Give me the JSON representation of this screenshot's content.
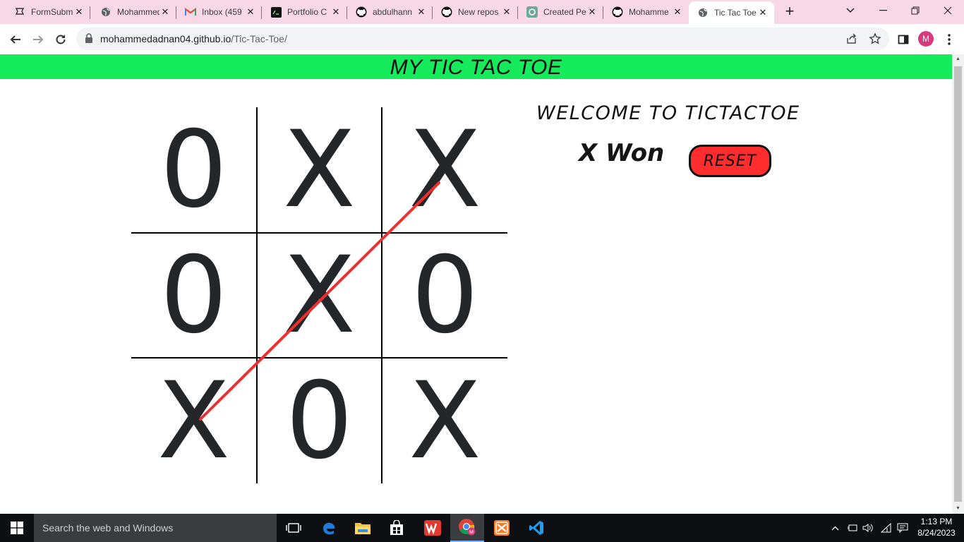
{
  "browser": {
    "tabs": [
      {
        "title": "FormSubmit",
        "icon": "formsubmit-icon"
      },
      {
        "title": "Mohammed",
        "icon": "globe-icon"
      },
      {
        "title": "Inbox (459",
        "icon": "gmail-icon"
      },
      {
        "title": "Portfolio C",
        "icon": "codepen-icon"
      },
      {
        "title": "abdulhann",
        "icon": "github-icon"
      },
      {
        "title": "New repos",
        "icon": "github-icon"
      },
      {
        "title": "Created Pe",
        "icon": "chatgpt-icon"
      },
      {
        "title": "Mohamme",
        "icon": "github-icon"
      },
      {
        "title": "Tic Tac Toe",
        "icon": "globe-icon",
        "active": true
      }
    ],
    "new_tab_label": "+",
    "url_host": "mohammedadnan04.github.io",
    "url_path": "/Tic-Tac-Toe/",
    "profile_initial": "M"
  },
  "page": {
    "banner_title": "MY TIC TAC TOE",
    "welcome": "WELCOME TO TICTACTOE",
    "status": "X Won",
    "reset_label": "RESET",
    "board": [
      "0",
      "X",
      "X",
      "0",
      "X",
      "0",
      "X",
      "0",
      "X"
    ],
    "winning_cells": [
      2,
      4,
      6
    ],
    "colors": {
      "banner": "#16eb5b",
      "reset": "#ff2d2d",
      "winline": "#ef2f2f"
    }
  },
  "taskbar": {
    "search_placeholder": "Search the web and Windows",
    "time": "1:13 PM",
    "date": "8/24/2023"
  }
}
